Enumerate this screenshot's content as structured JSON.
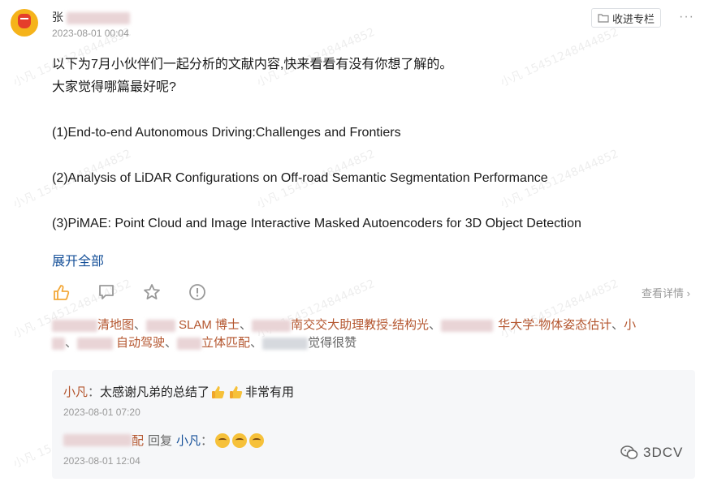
{
  "header": {
    "username_partial": "张",
    "timestamp": "2023-08-01 00:04",
    "collect_button": "收进专栏",
    "more_icon": "more-dots-icon"
  },
  "post": {
    "lines": [
      "以下为7月小伙伴们一起分析的文献内容,快来看看有没有你想了解的。",
      "大家觉得哪篇最好呢?",
      "",
      "(1)End-to-end Autonomous Driving:Challenges and Frontiers",
      "",
      "(2)Analysis of LiDAR Configurations on Off-road Semantic Segmentation Performance",
      "",
      "(3)PiMAE: Point Cloud and Image Interactive Masked Autoencoders for 3D Object Detection"
    ],
    "expand": "展开全部"
  },
  "actions": {
    "icons": [
      "thumbs-up-icon",
      "comment-icon",
      "star-icon",
      "report-icon"
    ],
    "details": "查看详情"
  },
  "likers": {
    "row1": [
      "清地图",
      "SLAM 博士",
      "南交交大助理教授-结构光",
      "华大学-物体姿态估计",
      "小"
    ],
    "row2": [
      "自动驾驶",
      "立体匹配"
    ],
    "suffix": "觉得很赞",
    "separator": "、"
  },
  "comments": [
    {
      "user": "小凡",
      "text_before": "太感谢凡弟的总结了",
      "text_after": "非常有用",
      "time": "2023-08-01 07:20"
    },
    {
      "user_partial": "配",
      "reply_word": "回复",
      "reply_to": "小凡",
      "time": "2023-08-01 12:04"
    }
  ],
  "brand": {
    "name": "3DCV",
    "icon": "wechat-icon"
  },
  "watermark": "小凡 15451248444852",
  "colors": {
    "link_blue": "#175199",
    "username_orange": "#b4562f",
    "comment_bg": "#f6f7f9"
  }
}
